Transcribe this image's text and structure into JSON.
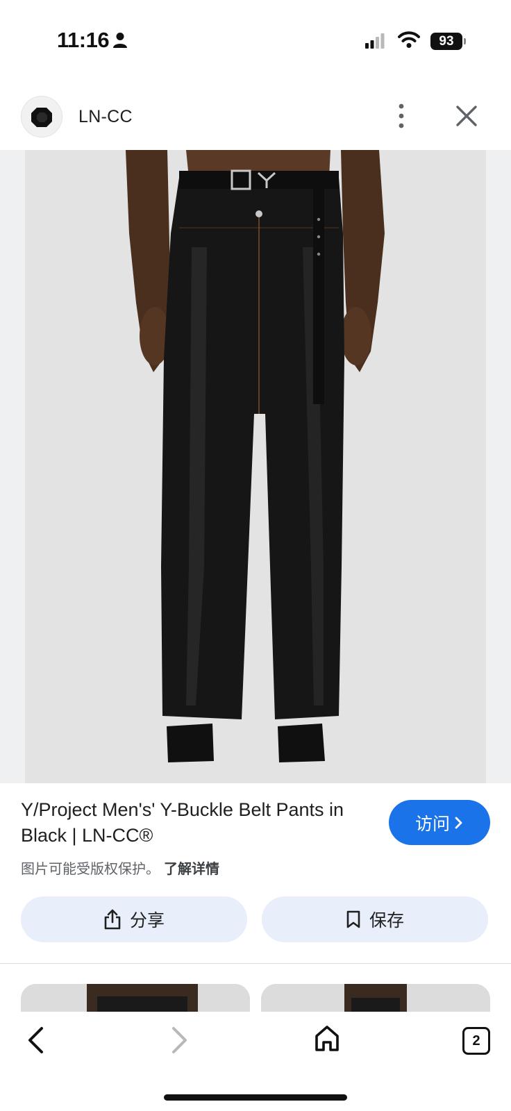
{
  "status_bar": {
    "time": "11:16",
    "battery": "93"
  },
  "header": {
    "site_name": "LN-CC"
  },
  "product": {
    "title": "Y/Project Men's' Y-Buckle Belt Pants in Black | LN-CC®",
    "visit_label": "访问",
    "copyright_notice": "图片可能受版权保护。",
    "learn_more": "了解详情"
  },
  "actions": {
    "share_label": "分享",
    "save_label": "保存"
  },
  "nav": {
    "tab_count": "2"
  },
  "colors": {
    "accent": "#1a73e8",
    "pill_bg": "#e8eefa",
    "image_bg": "#eef0f2"
  },
  "icons": [
    "person-icon",
    "signal-icon",
    "wifi-icon",
    "more-vertical-icon",
    "close-icon",
    "chevron-right-icon",
    "share-icon",
    "bookmark-icon",
    "back-arrow-icon",
    "forward-arrow-icon",
    "home-icon",
    "tabs-icon"
  ]
}
